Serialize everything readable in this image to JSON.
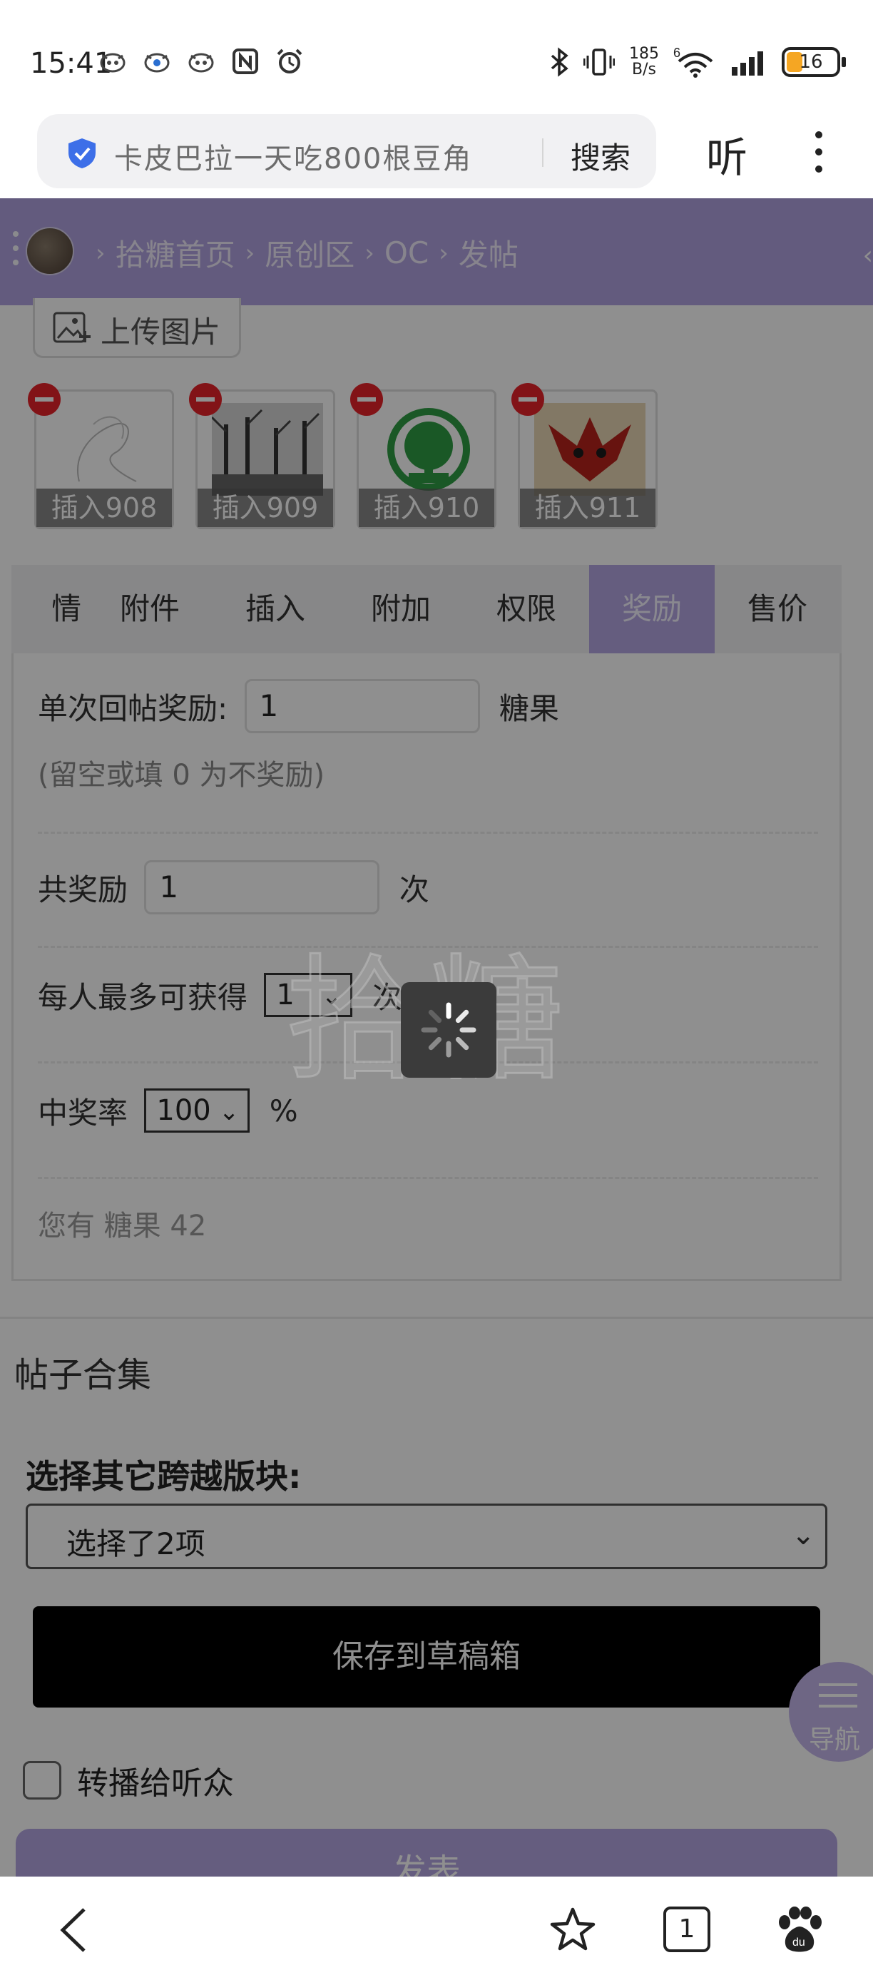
{
  "status_bar": {
    "time": "15:41",
    "net_speed_value": "185",
    "net_speed_unit": "B/s",
    "network": "6",
    "battery": "16",
    "battery_color": "#f5a623",
    "left_icons": [
      "pig-face-icon",
      "pig-face-icon",
      "pig-face-icon",
      "nfc-icon",
      "alarm-icon"
    ],
    "right_icons": [
      "bluetooth-icon",
      "vibrate-icon",
      "wifi-icon",
      "signal-icon",
      "battery-icon"
    ]
  },
  "browser": {
    "search_query": "卡皮巴拉一天吃800根豆角",
    "search_button": "搜索",
    "listen_button": "听",
    "menu_icon": "more-vert-icon"
  },
  "breadcrumb": {
    "items": [
      "拾糖首页",
      "原创区",
      "OC",
      "发帖"
    ],
    "accent_color": "#b1a3e0"
  },
  "upload": {
    "label": "上传图片"
  },
  "attachments": [
    {
      "caption": "插入908"
    },
    {
      "caption": "插入909"
    },
    {
      "caption": "插入910"
    },
    {
      "caption": "插入911"
    }
  ],
  "tabs": [
    {
      "label": "表情",
      "active": false
    },
    {
      "label": "附件",
      "active": false
    },
    {
      "label": "插入",
      "active": false
    },
    {
      "label": "附加",
      "active": false
    },
    {
      "label": "权限",
      "active": false
    },
    {
      "label": "奖励",
      "active": true
    },
    {
      "label": "售价",
      "active": false
    }
  ],
  "reward": {
    "per_reply_label": "单次回帖奖励:",
    "per_reply_value": "1",
    "per_reply_unit": "糖果",
    "per_reply_hint": "(留空或填 0 为不奖励)",
    "total_label": "共奖励",
    "total_value": "1",
    "total_unit": "次",
    "per_person_label": "每人最多可获得",
    "per_person_value": "1",
    "per_person_unit": "次",
    "rate_label": "中奖率",
    "rate_value": "100",
    "rate_unit": "%",
    "balance_text": "您有 糖果 42"
  },
  "collection": {
    "title": "帖子合集"
  },
  "cross_section": {
    "title": "选择其它跨越版块:",
    "selected_text": "选择了2项"
  },
  "actions": {
    "save_draft": "保存到草稿箱",
    "relay_label": "转播给听众",
    "relay_checked": false,
    "publish": "发表",
    "nav_label": "导航"
  },
  "overlay": {
    "watermark": "拾糖",
    "loading": true
  },
  "bottom_bar": {
    "tab_count": "1",
    "icons": [
      "back-icon",
      "star-icon",
      "tabs-icon",
      "baidu-paw-icon"
    ]
  }
}
